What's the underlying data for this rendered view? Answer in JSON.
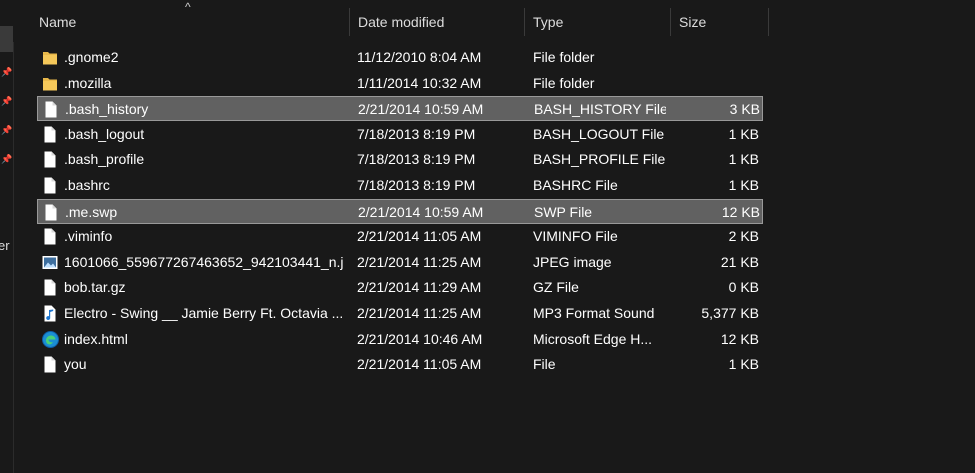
{
  "columns": {
    "name": "Name",
    "date": "Date modified",
    "type": "Type",
    "size": "Size"
  },
  "nav_partial_text": "er",
  "files": [
    {
      "name": ".gnome2",
      "date": "11/12/2010 8:04 AM",
      "type": "File folder",
      "size": "",
      "icon": "folder-icon",
      "selected": false
    },
    {
      "name": ".mozilla",
      "date": "1/11/2014 10:32 AM",
      "type": "File folder",
      "size": "",
      "icon": "folder-icon",
      "selected": false
    },
    {
      "name": ".bash_history",
      "date": "2/21/2014 10:59 AM",
      "type": "BASH_HISTORY File",
      "size": "3 KB",
      "icon": "file-icon",
      "selected": true
    },
    {
      "name": ".bash_logout",
      "date": "7/18/2013 8:19 PM",
      "type": "BASH_LOGOUT File",
      "size": "1 KB",
      "icon": "file-icon",
      "selected": false
    },
    {
      "name": ".bash_profile",
      "date": "7/18/2013 8:19 PM",
      "type": "BASH_PROFILE File",
      "size": "1 KB",
      "icon": "file-icon",
      "selected": false
    },
    {
      "name": ".bashrc",
      "date": "7/18/2013 8:19 PM",
      "type": "BASHRC File",
      "size": "1 KB",
      "icon": "file-icon",
      "selected": false
    },
    {
      "name": ".me.swp",
      "date": "2/21/2014 10:59 AM",
      "type": "SWP File",
      "size": "12 KB",
      "icon": "file-icon",
      "selected": true
    },
    {
      "name": ".viminfo",
      "date": "2/21/2014 11:05 AM",
      "type": "VIMINFO File",
      "size": "2 KB",
      "icon": "file-icon",
      "selected": false
    },
    {
      "name": "1601066_559677267463652_942103441_n.j...",
      "date": "2/21/2014 11:25 AM",
      "type": "JPEG image",
      "size": "21 KB",
      "icon": "image-icon",
      "selected": false
    },
    {
      "name": "bob.tar.gz",
      "date": "2/21/2014 11:29 AM",
      "type": "GZ File",
      "size": "0 KB",
      "icon": "file-icon",
      "selected": false
    },
    {
      "name": "Electro - Swing __ Jamie Berry Ft. Octavia ...",
      "date": "2/21/2014 11:25 AM",
      "type": "MP3 Format Sound",
      "size": "5,377 KB",
      "icon": "music-file-icon",
      "selected": false
    },
    {
      "name": "index.html",
      "date": "2/21/2014 10:46 AM",
      "type": "Microsoft Edge H...",
      "size": "12 KB",
      "icon": "edge-icon",
      "selected": false
    },
    {
      "name": "you",
      "date": "2/21/2014 11:05 AM",
      "type": "File",
      "size": "1 KB",
      "icon": "file-icon",
      "selected": false
    }
  ],
  "colors": {
    "background": "#191919",
    "selected_row": "#616161",
    "folder": "#e8b84a",
    "edge": "#1b8fd4"
  }
}
